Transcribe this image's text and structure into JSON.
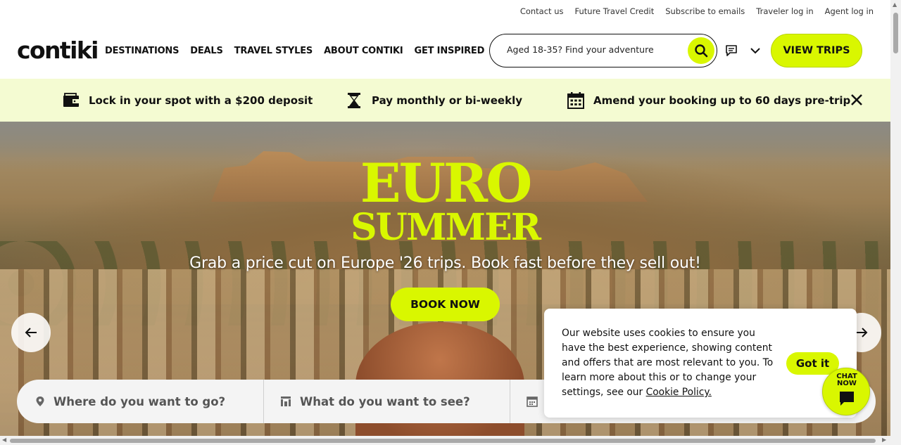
{
  "utility": {
    "links": [
      "Contact us",
      "Future Travel Credit",
      "Subscribe to emails",
      "Traveler log in",
      "Agent log in"
    ]
  },
  "header": {
    "logo": "contiki",
    "nav": [
      "DESTINATIONS",
      "DEALS",
      "TRAVEL STYLES",
      "ABOUT CONTIKI",
      "GET INSPIRED"
    ],
    "search_placeholder": "Aged 18-35? Find your adventure",
    "view_trips": "VIEW TRIPS"
  },
  "benefits": [
    {
      "icon": "wallet-icon",
      "text": "Lock in your spot with a $200 deposit"
    },
    {
      "icon": "hourglass-icon",
      "text": "Pay monthly or bi-weekly"
    },
    {
      "icon": "calendar-icon",
      "text": "Amend your booking up to 60 days pre-trip"
    }
  ],
  "hero": {
    "title_line1": "EURO",
    "title_line2": "SUMMER",
    "subtitle": "Grab a price cut on Europe '26 trips. Book fast before they sell out!",
    "cta": "BOOK NOW"
  },
  "trip_search": {
    "destination_placeholder": "Where do you want to go?",
    "interest_placeholder": "What do you want to see?"
  },
  "cookie": {
    "text": "Our website uses cookies to ensure you have the best experience, showing content and offers that are most relevant to you. To learn more about this or to change your settings, see our ",
    "link": "Cookie Policy.",
    "button": "Got it"
  },
  "chat": {
    "line1": "CHAT",
    "line2": "NOW"
  },
  "colors": {
    "accent": "#d9f700",
    "benefit_bar": "#f4fbd2"
  }
}
